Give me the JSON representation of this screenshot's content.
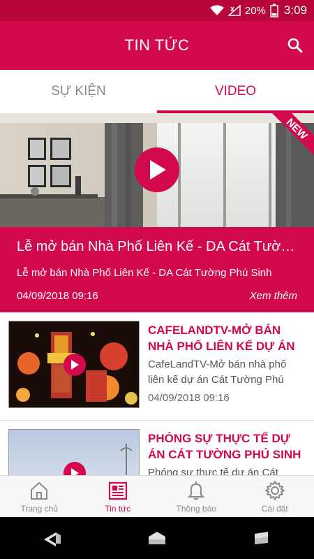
{
  "status_bar": {
    "battery": "20%",
    "time": "3:09",
    "icons": [
      "wifi-icon",
      "signal-icon",
      "battery-icon"
    ]
  },
  "app_bar": {
    "title": "TIN TỨC",
    "search_icon": "search-icon"
  },
  "tabs": [
    {
      "label": "SỰ KIỆN",
      "active": false
    },
    {
      "label": "VIDEO",
      "active": true
    }
  ],
  "featured": {
    "badge": "NEW",
    "title": "Lễ mở bán Nhà Phố Liên Kế - DA Cát Tường Phú Sinh",
    "subtitle": "Lễ mở bán Nhà Phố Liên Kế - DA Cát Tường Phú Sinh",
    "date": "04/09/2018 09:16",
    "more": "Xem thêm"
  },
  "items": [
    {
      "title": "CAFELANDTV-MỞ BÁN NHÀ PHỐ LIÊN KẾ DỰ ÁN CÁT TƯỜNG PHÚ SINH",
      "desc": "CafeLandTV-Mở bán nhà phố liên kế dự án Cát Tường Phú Sinh",
      "date": "04/09/2018 09:16"
    },
    {
      "title": "PHÓNG SỰ THỰC TẾ DỰ ÁN CÁT TƯỜNG PHÚ SINH",
      "desc": "Phóng sự thực tế dự án Cát Tường Phú Sinh",
      "date": ""
    }
  ],
  "bottom_nav": [
    {
      "label": "Trang chủ",
      "icon": "home-icon",
      "active": false
    },
    {
      "label": "Tin tức",
      "icon": "newspaper-icon",
      "active": true
    },
    {
      "label": "Thông báo",
      "icon": "bell-icon",
      "active": false
    },
    {
      "label": "Cài đặt",
      "icon": "gear-icon",
      "active": false
    }
  ],
  "colors": {
    "accent": "#d2094c",
    "status_bar": "#b8063b",
    "inactive": "#8a8a8a"
  }
}
